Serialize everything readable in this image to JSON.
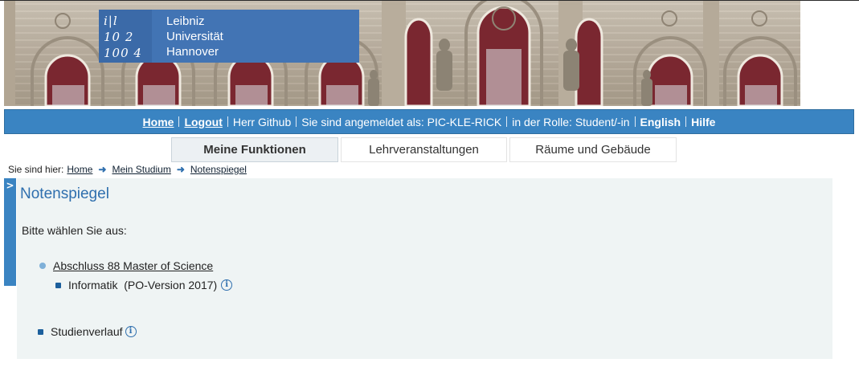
{
  "header": {
    "logo_mark_lines": [
      "i|l",
      "10 2",
      "100 4"
    ],
    "logo_text": [
      "Leibniz",
      "Universität",
      "Hannover"
    ]
  },
  "topnav": {
    "home": "Home",
    "logout": "Logout",
    "user": "Herr Github",
    "logged_in_as": "Sie sind angemeldet als: PIC-KLE-RICK",
    "role": "in der Rolle: Student/-in",
    "english": "English",
    "help": "Hilfe"
  },
  "tabs": [
    {
      "label": "Meine Funktionen",
      "active": true
    },
    {
      "label": "Lehrveranstaltungen",
      "active": false
    },
    {
      "label": "Räume und Gebäude",
      "active": false
    }
  ],
  "breadcrumb": {
    "prefix": "Sie sind hier:",
    "items": [
      "Home",
      "Mein Studium",
      "Notenspiegel"
    ]
  },
  "sidebar_toggle": ">",
  "main": {
    "title": "Notenspiegel",
    "prompt": "Bitte wählen Sie aus:",
    "degree_link": "Abschluss 88 Master of Science",
    "program": "Informatik  (PO-Version 2017)",
    "history": "Studienverlauf"
  },
  "colors": {
    "nav_blue": "#3a84c2",
    "logo_blue": "#4274b4",
    "panel_bg": "#eff4f4",
    "title_blue": "#2f6fae"
  }
}
